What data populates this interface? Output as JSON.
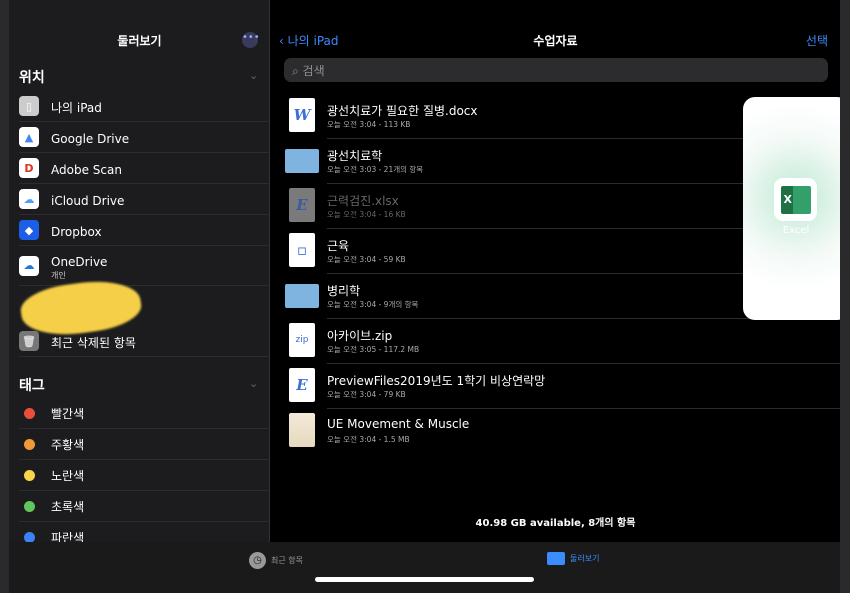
{
  "sidebar": {
    "title": "둘러보기",
    "more_icon": "ellipsis-circle-icon",
    "locations_header": "위치",
    "locations": [
      {
        "label": "나의 iPad",
        "icon": "ipad-icon"
      },
      {
        "label": "Google Drive",
        "icon": "google-drive-icon"
      },
      {
        "label": "Adobe Scan",
        "icon": "adobe-scan-icon"
      },
      {
        "label": "iCloud Drive",
        "icon": "icloud-icon"
      },
      {
        "label": "Dropbox",
        "icon": "dropbox-icon"
      },
      {
        "label": "OneDrive",
        "sub": "개인",
        "icon": "onedrive-icon"
      },
      {
        "label": "최근 삭제된 항목",
        "icon": "trash-icon"
      }
    ],
    "tags_header": "태그",
    "tags": [
      {
        "label": "빨간색",
        "color": "#eb4d3d"
      },
      {
        "label": "주황색",
        "color": "#f09a37"
      },
      {
        "label": "노란색",
        "color": "#f7d64a"
      },
      {
        "label": "초록색",
        "color": "#5fc75b"
      },
      {
        "label": "파란색",
        "color": "#3b82f6"
      }
    ]
  },
  "main": {
    "back_label": "나의 iPad",
    "title": "수업자료",
    "select_label": "선택",
    "search_placeholder": "검색",
    "files": [
      {
        "name": "광선치료가 필요한 질병.docx",
        "meta": "오늘 오전 3:04 - 113 KB",
        "type": "word",
        "glyph": "W"
      },
      {
        "name": "광선치료학",
        "meta": "오늘 오전 3:03 - 21개의 항목",
        "type": "folder",
        "glyph": ""
      },
      {
        "name": "근력검진.xlsx",
        "meta": "오늘 오전 3:04 - 16 KB",
        "type": "dim",
        "glyph": "E"
      },
      {
        "name": "근육",
        "meta": "오늘 오전 3:04 - 59 KB",
        "type": "doc",
        "glyph": "▫"
      },
      {
        "name": "병리학",
        "meta": "오늘 오전 3:04 - 9개의 항목",
        "type": "folder",
        "glyph": ""
      },
      {
        "name": "아카이브.zip",
        "meta": "오늘 오전 3:05 - 117.2 MB",
        "type": "zip",
        "glyph": "zip"
      },
      {
        "name": "PreviewFiles2019년도 1학기 비상연락망",
        "meta": "오늘 오전 3:04 - 79 KB",
        "type": "e",
        "glyph": "E"
      },
      {
        "name": "UE Movement & Muscle",
        "meta": "오늘 오전 3:04 - 1.5 MB",
        "type": "image",
        "glyph": ""
      }
    ],
    "footer": "40.98 GB available, 8개의 항목"
  },
  "slide_over": {
    "app": "Excel",
    "glyph": "X"
  },
  "tabbar": {
    "recent": "최근 항목",
    "browse": "둘러보기",
    "active_color": "#3b8cff"
  }
}
